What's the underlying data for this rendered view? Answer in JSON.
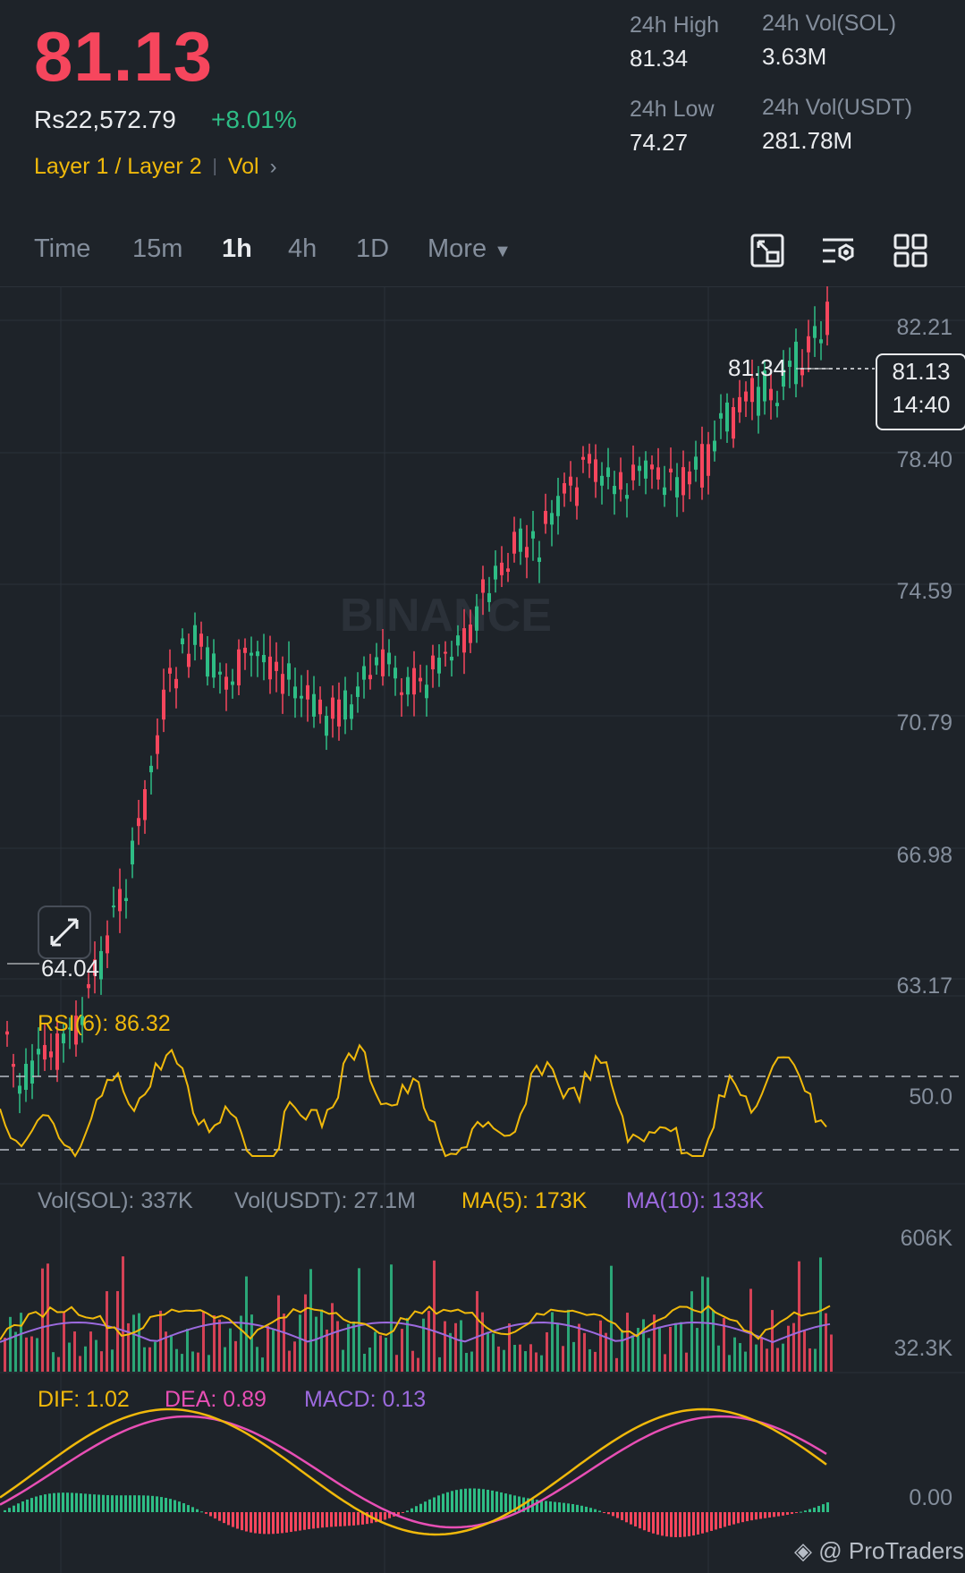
{
  "header": {
    "last_price": "81.13",
    "fiat_price": "Rs22,572.79",
    "change_pct": "+8.01%",
    "tags": {
      "category": "Layer 1 / Layer 2",
      "vol": "Vol"
    }
  },
  "stats": {
    "high_label": "24h High",
    "high_value": "81.34",
    "low_label": "24h Low",
    "low_value": "74.27",
    "vol_sol_label": "24h Vol(SOL)",
    "vol_sol_value": "3.63M",
    "vol_usdt_label": "24h Vol(USDT)",
    "vol_usdt_value": "281.78M"
  },
  "timeframes": {
    "items": [
      "Time",
      "15m",
      "1h",
      "4h",
      "1D"
    ],
    "active": "1h",
    "more": "More"
  },
  "toolbar_icons": [
    "chart-switch-icon",
    "settings-sliders-icon",
    "grid-layout-icon"
  ],
  "main_chart": {
    "price_axis": [
      "82.21",
      "78.40",
      "74.59",
      "70.79",
      "66.98",
      "63.17"
    ],
    "high_marker": "81.34",
    "low_marker": "64.04",
    "current_price": "81.13",
    "countdown": "14:40",
    "watermark": "BINANCE"
  },
  "rsi": {
    "label": "RSI(6): 86.32",
    "axis": "50.0"
  },
  "volume": {
    "vol_sol": "Vol(SOL): 337K",
    "vol_usdt": "Vol(USDT): 27.1M",
    "ma5": "MA(5): 173K",
    "ma10": "MA(10): 133K",
    "axis_top": "606K",
    "axis_bottom": "32.3K"
  },
  "macd": {
    "dif": "DIF: 1.02",
    "dea": "DEA: 0.89",
    "macd": "MACD: 0.13",
    "axis": "0.00"
  },
  "footer": {
    "brand": "@ ProTraders"
  },
  "colors": {
    "up": "#2ebd85",
    "down": "#f6465d",
    "accent": "#f0b90b",
    "ma10": "#9c6ade",
    "dea": "#e84fb5"
  }
}
